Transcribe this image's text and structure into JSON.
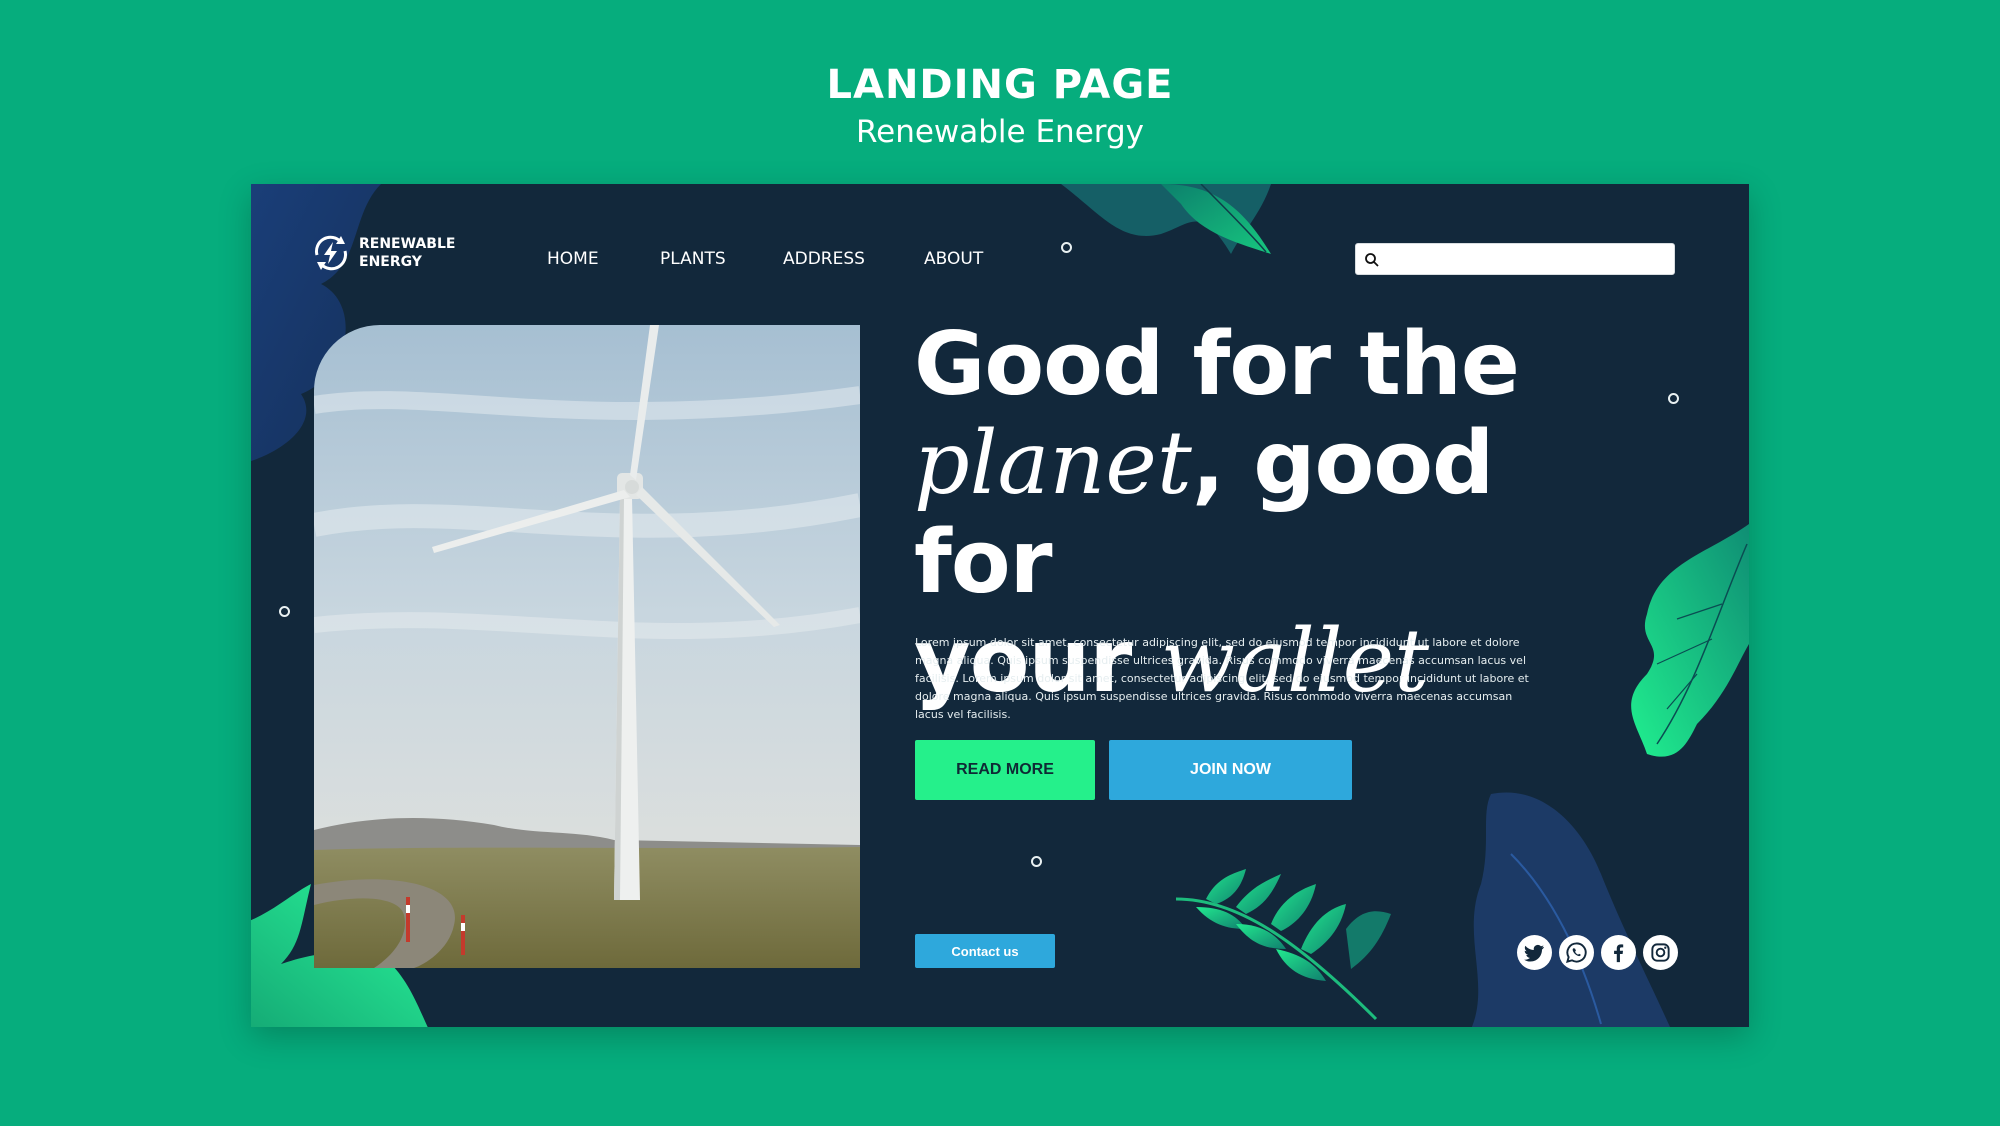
{
  "outer": {
    "title": "LANDING PAGE",
    "subtitle": "Renewable Energy"
  },
  "logo": {
    "line1": "RENEWABLE",
    "line2": "ENERGY",
    "icon": "renewable-energy-icon"
  },
  "nav": {
    "items": [
      "HOME",
      "PLANTS",
      "ADDRESS",
      "ABOUT"
    ]
  },
  "search": {
    "placeholder": "",
    "icon": "search-icon"
  },
  "hero": {
    "line1": "Good for the",
    "line2_italic": "planet",
    "line2_rest": ", good for",
    "line3_normal": "your ",
    "line3_italic": "wallet",
    "body": "Lorem ipsum dolor sit amet, consectetur adipiscing elit, sed do eiusmod tempor incididunt ut labore et dolore magna aliqua. Quis ipsum suspendisse ultrices gravida. Risus commodo viverra maecenas accumsan lacus vel facilisis.  Lorem ipsum dolor sit amet, consectetur adipiscing elit, sed do eiusmod tempor incididunt ut labore et dolore magna aliqua. Quis ipsum suspendisse ultrices gravida. Risus commodo viverra maecenas accumsan lacus vel facilisis."
  },
  "buttons": {
    "read_more": "READ MORE",
    "join_now": "JOIN NOW",
    "contact": "Contact us"
  },
  "socials": [
    "twitter-icon",
    "whatsapp-icon",
    "facebook-icon",
    "instagram-icon"
  ],
  "colors": {
    "background": "#06ad7d",
    "card": "#12283b",
    "accent_green": "#25f08b",
    "accent_blue": "#2ea8dc"
  }
}
